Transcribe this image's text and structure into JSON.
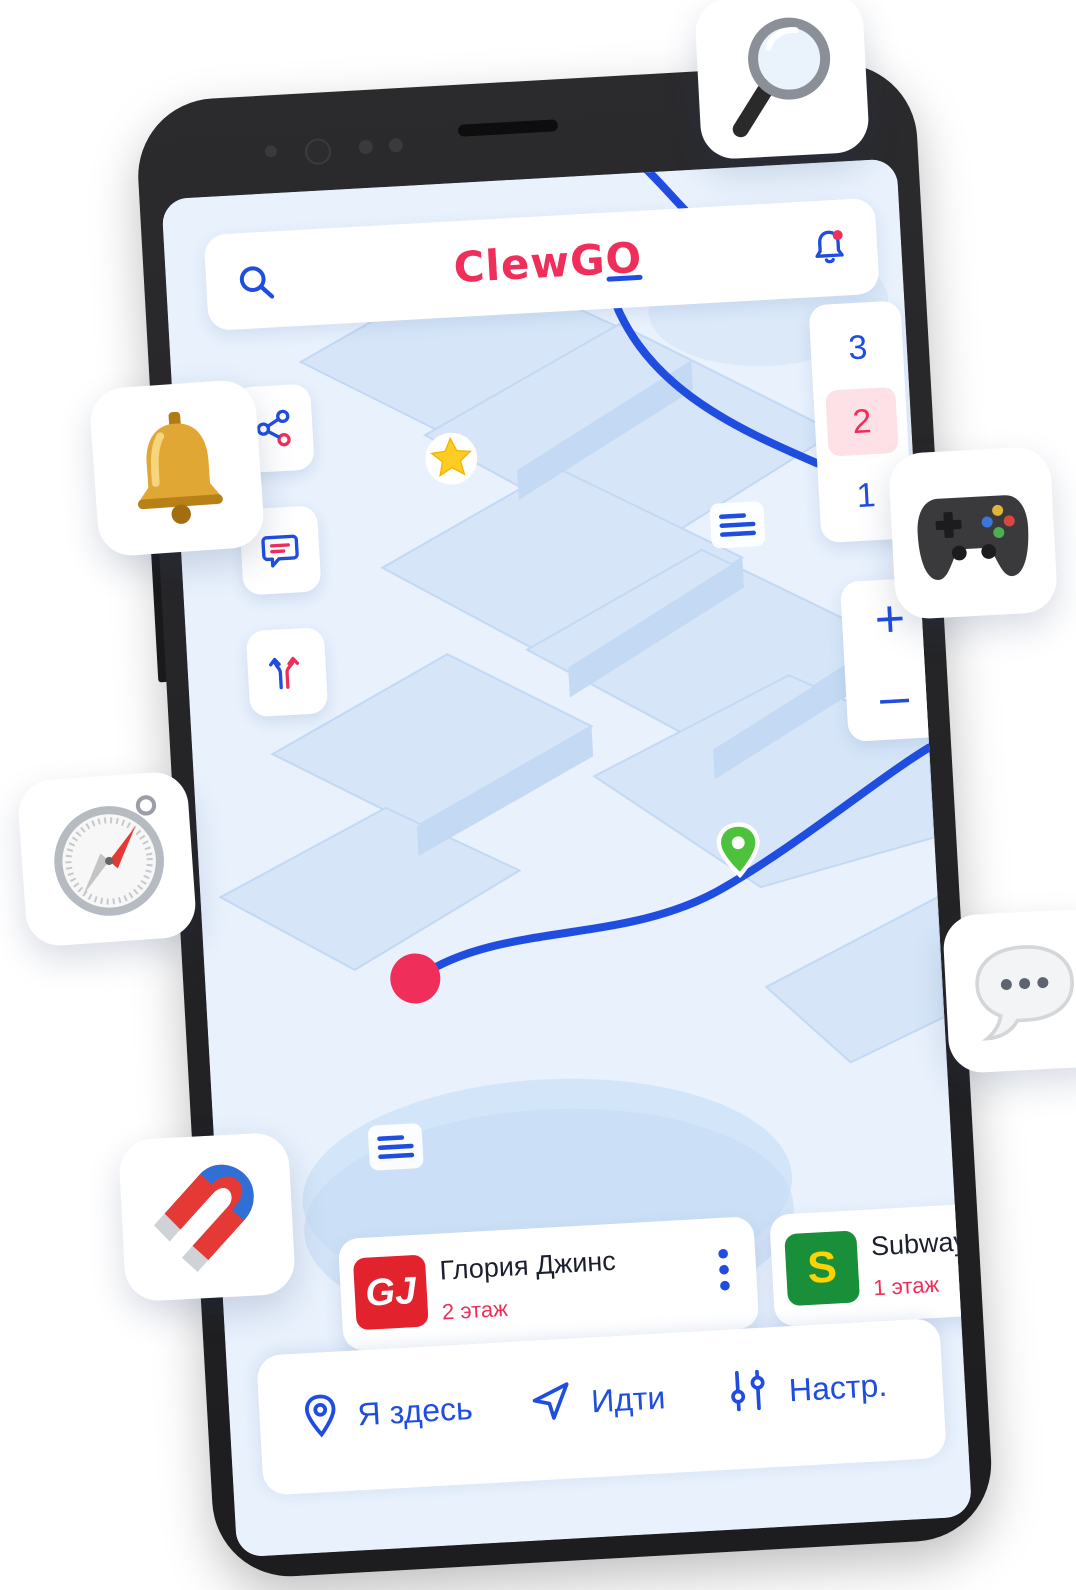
{
  "app": {
    "name": "ClewGO"
  },
  "topbar": {
    "search_icon": "search-icon",
    "bell_icon": "bell-notification-icon",
    "logo_text": "ClewGO"
  },
  "floors": {
    "items": [
      "3",
      "2",
      "1"
    ],
    "selected": "2"
  },
  "zoom": {
    "in_label": "+",
    "out_label": "–"
  },
  "tools": [
    {
      "name": "share-icon"
    },
    {
      "name": "chat-icon"
    },
    {
      "name": "routes-icon"
    }
  ],
  "stores": [
    {
      "name": "Глория Джинс",
      "floor": "2 этаж",
      "logo_text": "GJ",
      "logo_color": "#e2232e"
    },
    {
      "name": "Subway",
      "floor": "1 этаж",
      "logo_text": "S",
      "logo_color": "#1a8f3a"
    }
  ],
  "bottom_nav": {
    "here_label": "Я здесь",
    "go_label": "Идти",
    "settings_label": "Настр."
  },
  "floating_icons": [
    "magnifier",
    "bell",
    "gamepad",
    "compass",
    "speech-bubble",
    "magnet"
  ],
  "colors": {
    "accent_blue": "#1f4de0",
    "accent_red": "#ef2f5a",
    "map_bg": "#e8f1fc",
    "pin_green": "#4cc23d"
  }
}
